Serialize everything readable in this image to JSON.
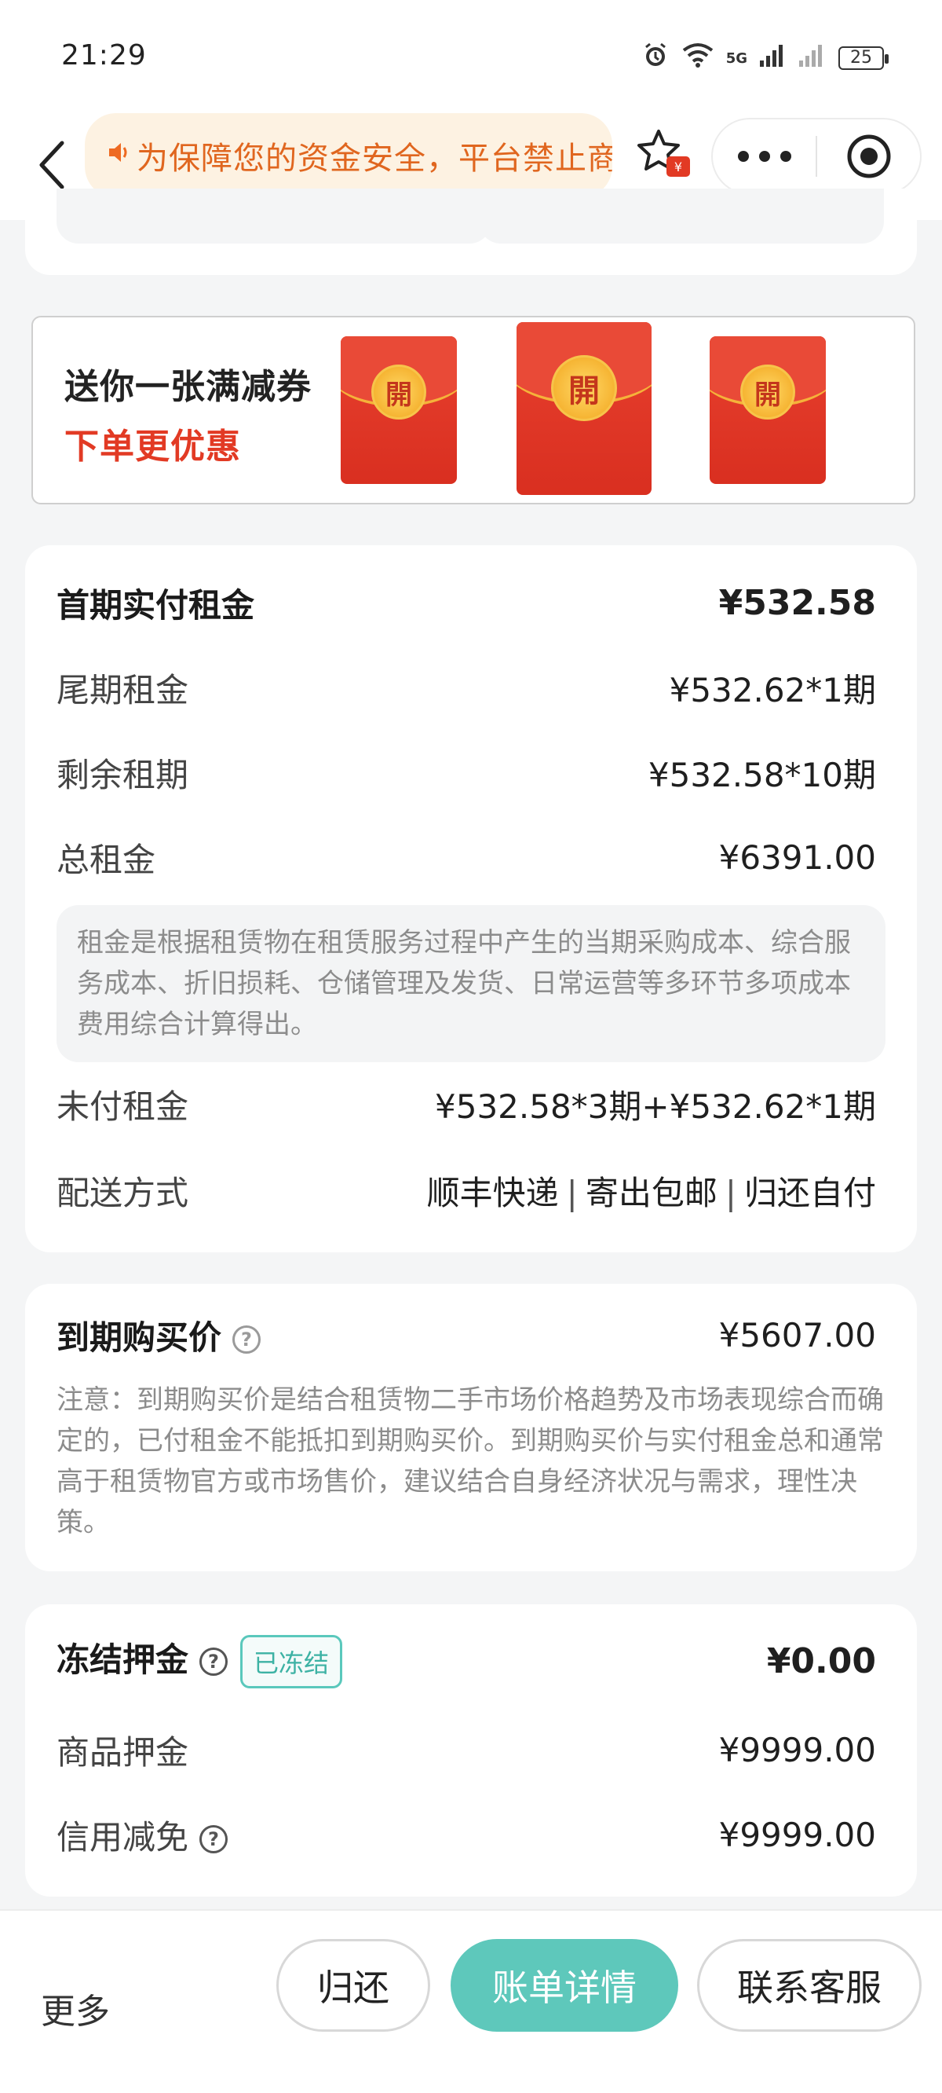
{
  "status_bar": {
    "time": "21:29",
    "signal_label": "5G",
    "battery": "25"
  },
  "nav": {
    "notice": "为保障您的资金安全，平台禁止商家任",
    "fav_badge": "¥"
  },
  "coupon": {
    "title": "送你一张满减券",
    "subtitle": "下单更优惠",
    "envelope_label": "開"
  },
  "rent": {
    "first_label": "首期实付租金",
    "first_value": "¥532.58",
    "last_label": "尾期租金",
    "last_value": "¥532.62*1期",
    "remaining_label": "剩余租期",
    "remaining_value": "¥532.58*10期",
    "total_label": "总租金",
    "total_value": "¥6391.00",
    "note": "租金是根据租赁物在租赁服务过程中产生的当期采购成本、综合服务成本、折旧损耗、仓储管理及发货、日常运营等多环节多项成本费用综合计算得出。",
    "unpaid_label": "未付租金",
    "unpaid_value": "¥532.58*3期+¥532.62*1期",
    "delivery_label": "配送方式",
    "delivery_values": [
      "顺丰快递",
      "寄出包邮",
      "归还自付"
    ],
    "delivery_sep": "|"
  },
  "purchase": {
    "label": "到期购买价",
    "value": "¥5607.00",
    "note": "注意：到期购买价是结合租赁物二手市场价格趋势及市场表现综合而确定的，已付租金不能抵扣到期购买价。到期购买价与实付租金总和通常高于租赁物官方或市场售价，建议结合自身经济状况与需求，理性决策。"
  },
  "deposit": {
    "label": "冻结押金",
    "badge": "已冻结",
    "value": "¥0.00",
    "goods_label": "商品押金",
    "goods_value": "¥9999.00",
    "credit_label": "信用减免",
    "credit_value": "¥9999.00"
  },
  "bottom": {
    "more": "更多",
    "return": "归还",
    "bill": "账单详情",
    "contact": "联系客服"
  },
  "colors": {
    "accent": "#5ec8bb",
    "notice_text": "#e0661f",
    "coupon_red": "#e23a24"
  },
  "icons": {
    "help": "?"
  }
}
